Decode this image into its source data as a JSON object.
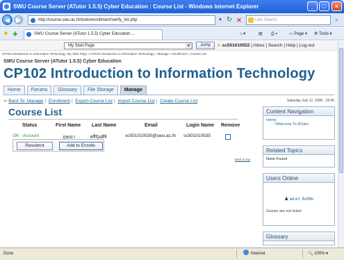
{
  "window": {
    "title": "SWU Course Server (ATutor 1.5.5) Cyber Education : Course List - Windows Internet Explorer",
    "buttons": {
      "minimize": "_",
      "maximize": "□",
      "close": "×"
    }
  },
  "addressbar": {
    "url": "http://course.swu.ac.th/tools/enrollment/verify_list.php",
    "search_placeholder": "Live Search"
  },
  "tabbar": {
    "tab_title": "SWU Course Server (ATutor 1.5.5) Cyber Education ...",
    "page_label": "Page",
    "tools_label": "Tools"
  },
  "page": {
    "jump": {
      "selected": "My Start Page",
      "button": "Jump"
    },
    "userlinks": {
      "user": "sc501010552",
      "inbox": "Inbox",
      "search": "Search",
      "help": "Help",
      "logout": "Log-out"
    },
    "breadcrumb": "CP102 Introduction to Information Technology: My Start Page » CP102 Introduction to Information Technology » Manage » Enrollment » Course List",
    "server_name": "SWU Course Server (ATutor 1.5.5) Cyber Education",
    "course_title": "CP102 Introduction to Information Technology",
    "nav_tabs": [
      "Home",
      "Forums",
      "Glossary",
      "File Storage",
      "Manage"
    ],
    "sublinks": {
      "back": "Back To: Manage",
      "enrollment": "Enrollment",
      "export": "Export Course List",
      "import": "Import Course List",
      "create": "Create Course List"
    },
    "date": "Saturday July 12, 2008 - 18:40",
    "heading": "Course List",
    "table": {
      "headers": [
        "Status",
        "First Name",
        "Last Name",
        "Email",
        "Login Name",
        "Remove"
      ],
      "row": {
        "status": "OK - Account exists",
        "first_name": "ภูษณา",
        "last_name": "ศรีนิจศิริ",
        "email": "sc501010535@swu.ac.th",
        "login": "sc501010535"
      }
    },
    "buttons": {
      "resubmit": "Resubmit",
      "add": "Add to Enrolle"
    },
    "top_link": "back to top"
  },
  "sidebar": {
    "content_nav": {
      "title": "Content Navigation",
      "home": "Home",
      "welcome": "Welcome To ATutor"
    },
    "related": {
      "title": "Related Topics",
      "body": "None Found"
    },
    "users_online": {
      "title": "Users Online",
      "user": "ผศ.ดร. สิงห์ทัย",
      "guests": "Guests are not listed"
    },
    "glossary": {
      "title": "Glossary"
    }
  },
  "statusbar": {
    "status": "Done",
    "zone": "Internet",
    "zoom": "100%"
  }
}
